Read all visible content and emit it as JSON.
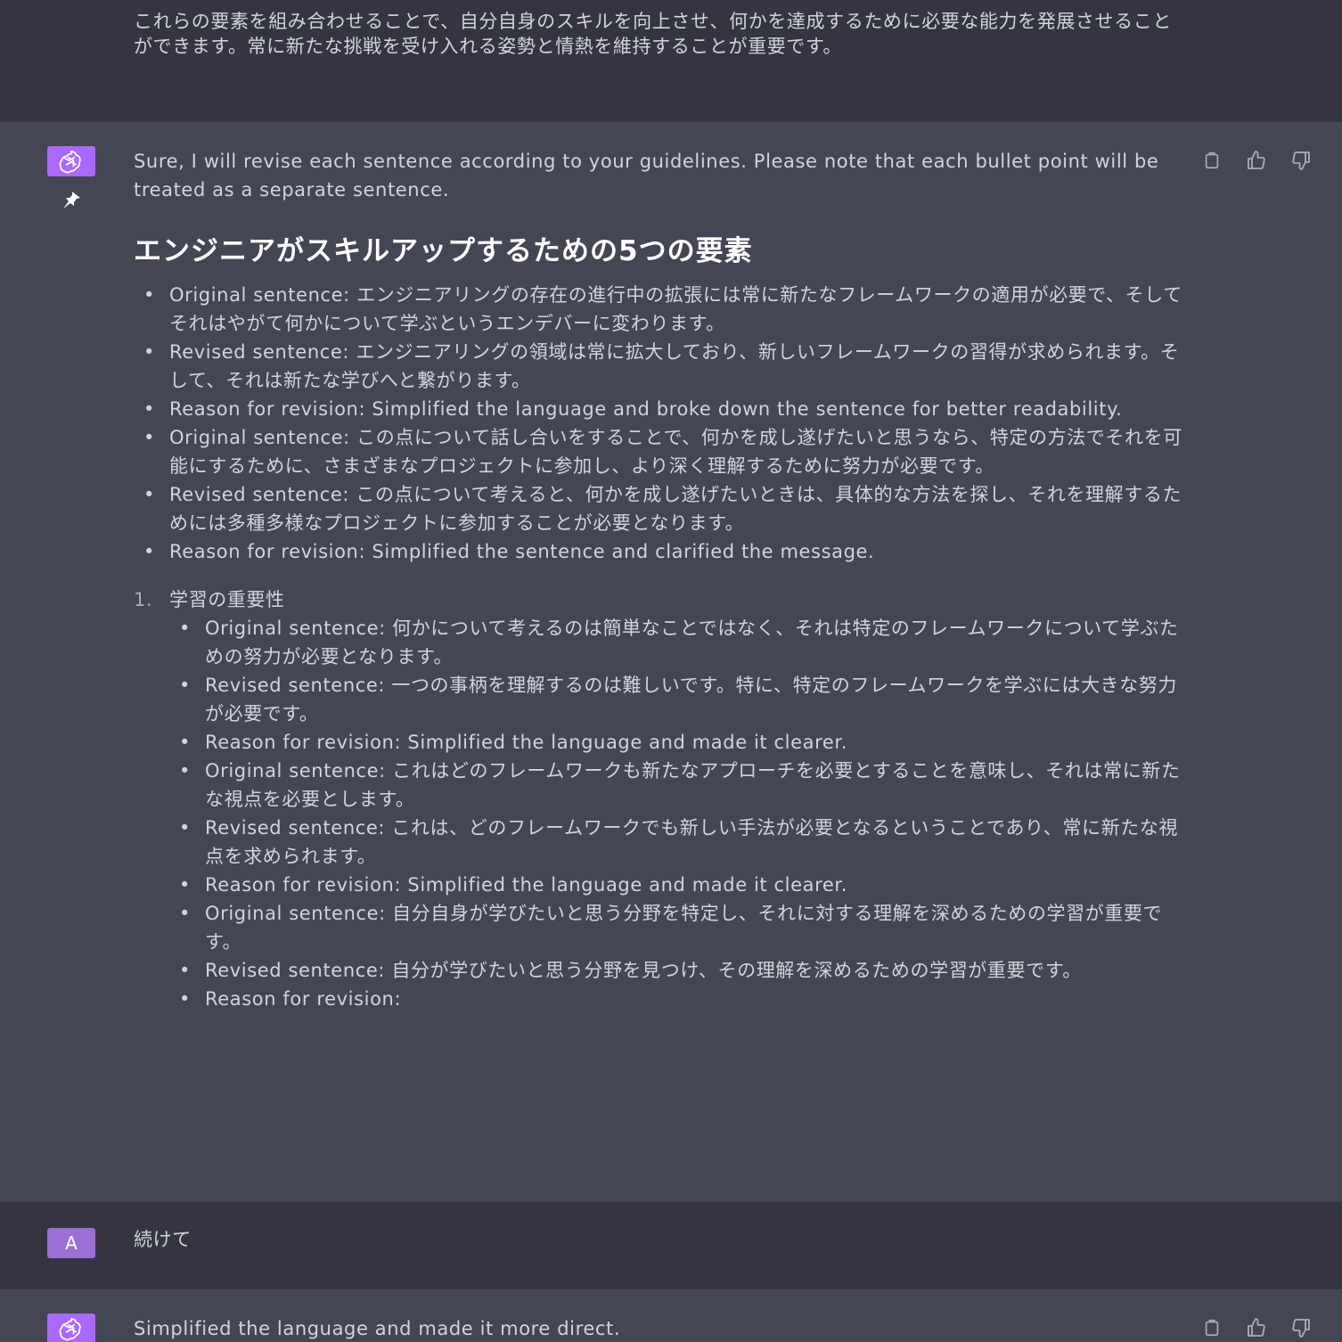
{
  "top_message": {
    "text": "これらの要素を組み合わせることで、自分自身のスキルを向上させ、何かを達成するために必要な能力を発展させることができます。常に新たな挑戦を受け入れる姿勢と情熱を維持することが重要です。"
  },
  "assistant_message_1": {
    "intro": "Sure, I will revise each sentence according to your guidelines. Please note that each bullet point will be treated as a separate sentence.",
    "heading": "エンジニアがスキルアップするための5つの要素",
    "bullets": [
      "Original sentence: エンジニアリングの存在の進行中の拡張には常に新たなフレームワークの適用が必要で、そしてそれはやがて何かについて学ぶというエンデバーに変わります。",
      "Revised sentence: エンジニアリングの領域は常に拡大しており、新しいフレームワークの習得が求められます。そして、それは新たな学びへと繋がります。",
      "Reason for revision: Simplified the language and broke down the sentence for better readability.",
      "Original sentence: この点について話し合いをすることで、何かを成し遂げたいと思うなら、特定の方法でそれを可能にするために、さまざまなプロジェクトに参加し、より深く理解するために努力が必要です。",
      "Revised sentence: この点について考えると、何かを成し遂げたいときは、具体的な方法を探し、それを理解するためには多種多様なプロジェクトに参加することが必要となります。",
      "Reason for revision: Simplified the sentence and clarified the message."
    ],
    "numbered": {
      "number": "1.",
      "title": "学習の重要性",
      "bullets": [
        "Original sentence: 何かについて考えるのは簡単なことではなく、それは特定のフレームワークについて学ぶための努力が必要となります。",
        "Revised sentence: 一つの事柄を理解するのは難しいです。特に、特定のフレームワークを学ぶには大きな努力が必要です。",
        "Reason for revision: Simplified the language and made it clearer.",
        "Original sentence: これはどのフレームワークも新たなアプローチを必要とすることを意味し、それは常に新たな視点を必要とします。",
        "Revised sentence: これは、どのフレームワークでも新しい手法が必要となるということであり、常に新たな視点を求められます。",
        "Reason for revision: Simplified the language and made it clearer.",
        "Original sentence: 自分自身が学びたいと思う分野を特定し、それに対する理解を深めるための学習が重要です。",
        "Revised sentence: 自分が学びたいと思う分野を見つけ、その理解を深めるための学習が重要です。",
        "Reason for revision:"
      ]
    }
  },
  "user_message": {
    "avatar_letter": "A",
    "text": "続けて"
  },
  "assistant_message_2": {
    "text": "Simplified the language and made it more direct."
  },
  "icons": {
    "avatar": "openai-logo-icon",
    "pin": "pin-icon",
    "copy": "clipboard-icon",
    "like": "thumbs-up-icon",
    "dislike": "thumbs-down-icon"
  },
  "colors": {
    "page_bg": "#343541",
    "assistant_bg": "#444654",
    "assistant_avatar": "#ab68ff",
    "user_avatar": "#9b6fd4"
  }
}
